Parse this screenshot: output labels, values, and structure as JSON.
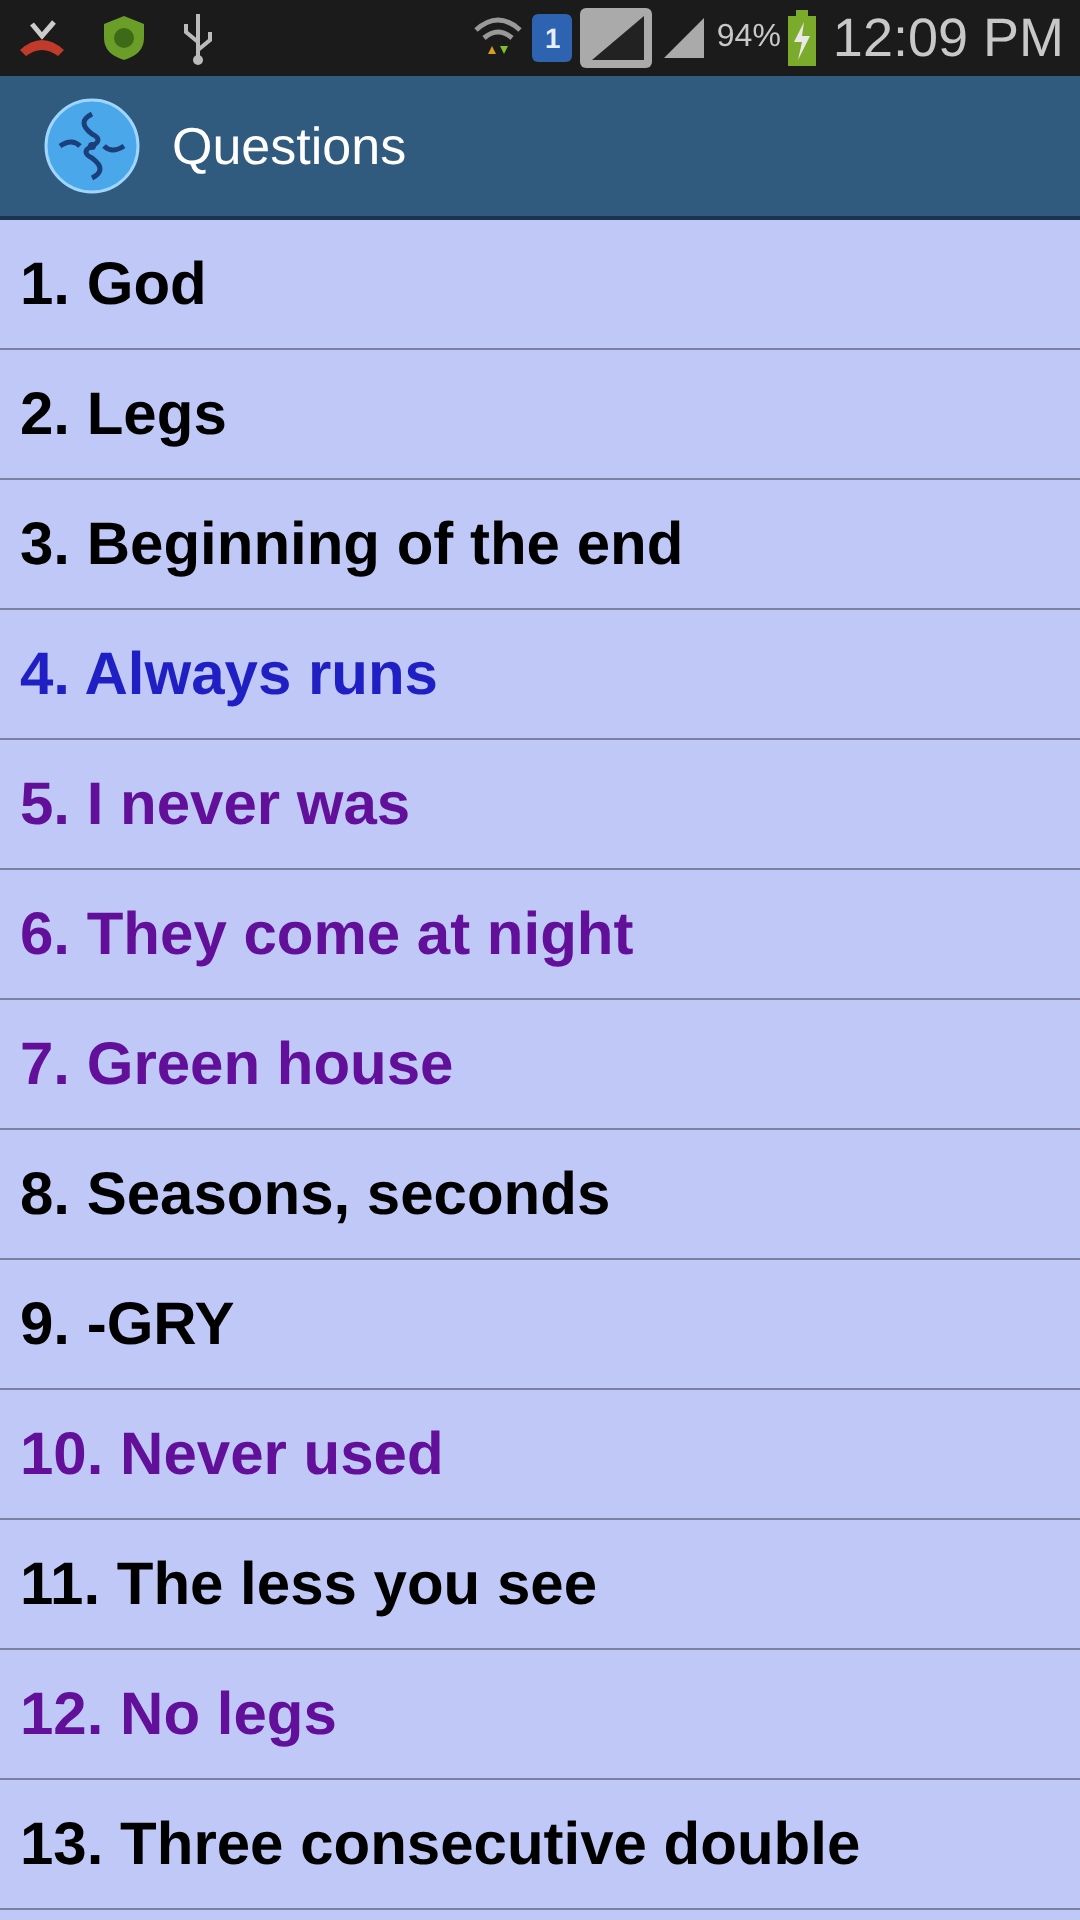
{
  "status_bar": {
    "sim": "1",
    "battery": "94%",
    "time": "12:09 PM"
  },
  "action_bar": {
    "title": "Questions"
  },
  "questions": [
    {
      "label": "1. God",
      "color": "#000000"
    },
    {
      "label": "2. Legs",
      "color": "#000000"
    },
    {
      "label": "3. Beginning of the end",
      "color": "#000000"
    },
    {
      "label": "4. Always runs",
      "color": "#1f1fc4"
    },
    {
      "label": "5. I never was",
      "color": "#62109a"
    },
    {
      "label": "6. They come at night",
      "color": "#62109a"
    },
    {
      "label": "7. Green house",
      "color": "#62109a"
    },
    {
      "label": "8. Seasons, seconds",
      "color": "#000000"
    },
    {
      "label": "9. -GRY",
      "color": "#000000"
    },
    {
      "label": "10. Never used",
      "color": "#62109a"
    },
    {
      "label": "11. The less you see",
      "color": "#000000"
    },
    {
      "label": "12. No legs",
      "color": "#62109a"
    },
    {
      "label": "13. Three consecutive double",
      "color": "#000000"
    }
  ]
}
